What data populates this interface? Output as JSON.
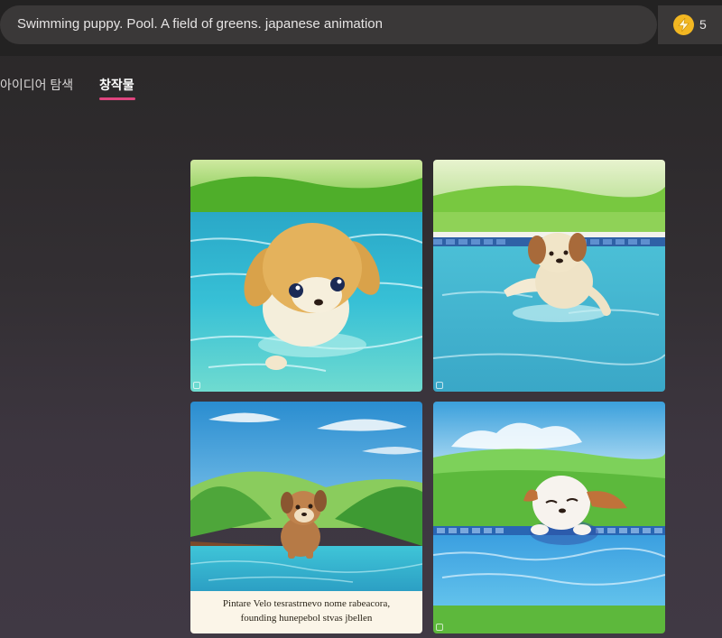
{
  "search": {
    "prompt": "Swimming puppy. Pool. A field of greens. japanese animation"
  },
  "boosts": {
    "count": "5",
    "icon": "lightning-bolt-icon"
  },
  "tabs": [
    {
      "label": "아이디어 탐색",
      "active": false
    },
    {
      "label": "창작물",
      "active": true
    }
  ],
  "results": {
    "images": [
      {
        "subject": "golden puppy swimming in pool facing viewer"
      },
      {
        "subject": "fluffy puppy paddling in pool with grass field"
      },
      {
        "subject": "brown puppy standing in pool under blue sky"
      },
      {
        "subject": "white puppy with eyes closed resting at pool edge"
      }
    ],
    "caption_tile3_lines": [
      "Pintare Velo tesrastrnevo nome rabeacora,",
      "founding hunepebol stvas jbellen"
    ]
  },
  "colors": {
    "accent": "#e0457f",
    "boost": "#f2b722"
  }
}
